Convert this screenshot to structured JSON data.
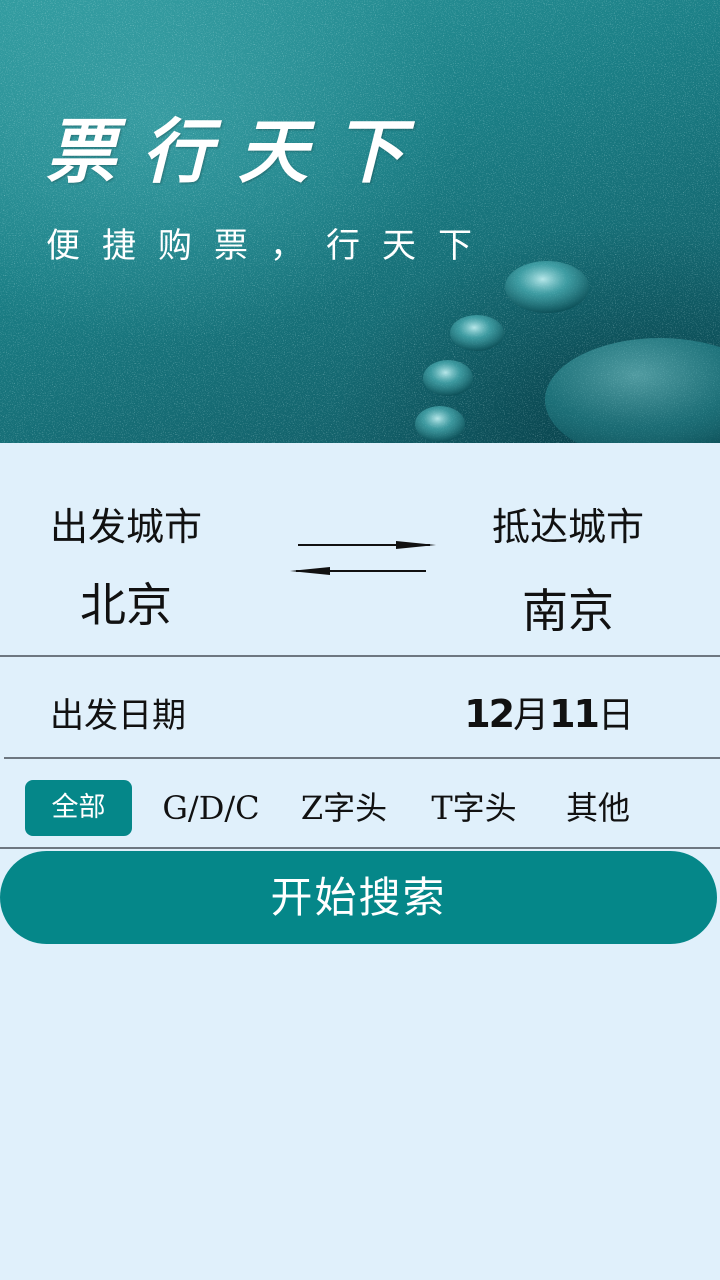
{
  "banner": {
    "title": "票行天下",
    "subtitle": "便捷购票，行天下"
  },
  "route": {
    "from_label": "出发城市",
    "from_city": "北京",
    "to_label": "抵达城市",
    "to_city": "南京",
    "swap_icon": "swap-arrows-icon"
  },
  "date": {
    "label": "出发日期",
    "month": "12",
    "month_unit": "月",
    "day": "11",
    "day_unit": "日"
  },
  "train_types": {
    "selected": "全部",
    "options": [
      "全部",
      "G/D/C",
      "Z字头",
      "T字头",
      "其他"
    ]
  },
  "search_button": "开始搜索",
  "colors": {
    "accent": "#058789",
    "background": "#e0f0fb",
    "divider": "#6e7780"
  }
}
